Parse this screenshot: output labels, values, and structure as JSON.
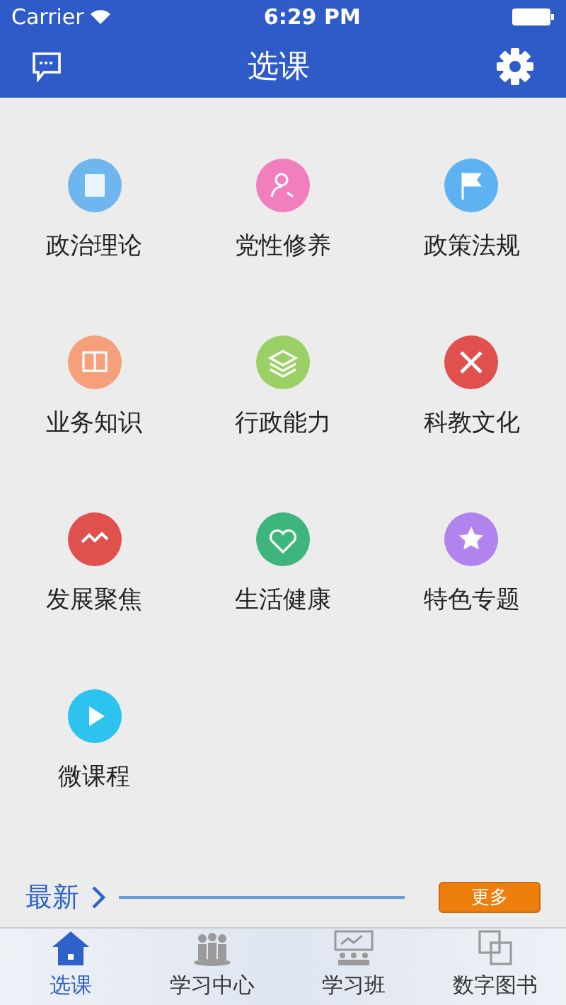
{
  "status_bar": {
    "carrier": "Carrier",
    "time": "6:29 PM"
  },
  "nav": {
    "title": "选课"
  },
  "categories": [
    {
      "label": "政治理论",
      "color": "#6fb6ee"
    },
    {
      "label": "党性修养",
      "color": "#f17fbd"
    },
    {
      "label": "政策法规",
      "color": "#5db3f2"
    },
    {
      "label": "业务知识",
      "color": "#f5a07a"
    },
    {
      "label": "行政能力",
      "color": "#9bd065"
    },
    {
      "label": "科教文化",
      "color": "#e0504c"
    },
    {
      "label": "发展聚焦",
      "color": "#e0504c"
    },
    {
      "label": "生活健康",
      "color": "#3db57d"
    },
    {
      "label": "特色专题",
      "color": "#b083ee"
    },
    {
      "label": "微课程",
      "color": "#2cc4ee"
    }
  ],
  "latest": {
    "label": "最新",
    "more": "更多"
  },
  "tabs": [
    {
      "label": "选课",
      "selected": true
    },
    {
      "label": "学习中心",
      "selected": false
    },
    {
      "label": "学习班",
      "selected": false
    },
    {
      "label": "数字图书",
      "selected": false
    }
  ]
}
